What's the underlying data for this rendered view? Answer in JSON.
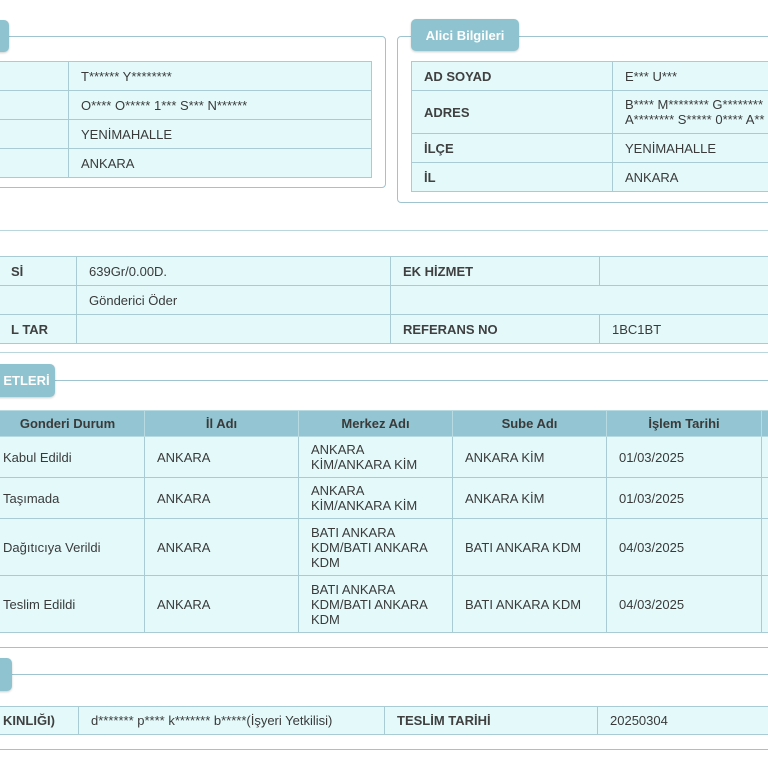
{
  "sender": {
    "tab_label": "",
    "rows": [
      {
        "label": "",
        "value": "T****** Y********"
      },
      {
        "label": "",
        "value": "O**** O***** 1*** S*** N******"
      },
      {
        "label": "",
        "value": "YENİMAHALLE"
      },
      {
        "label": "",
        "value": "ANKARA"
      }
    ]
  },
  "receiver": {
    "tab_label": "Alici Bilgileri",
    "rows": [
      {
        "label": "AD SOYAD",
        "value": "E*** U***"
      },
      {
        "label": "ADRES",
        "value": "B**** M******** G********\nA******** S***** 0**** A**"
      },
      {
        "label": "İLÇE",
        "value": "YENİMAHALLE"
      },
      {
        "label": "İL",
        "value": "ANKARA"
      }
    ]
  },
  "shipment": {
    "r1": {
      "l1": "Sİ",
      "v1": "639Gr/0.00D.",
      "l2": "EK HİZMET",
      "v2": ""
    },
    "r2": {
      "l1": "",
      "v1": "Gönderici Öder"
    },
    "r3": {
      "l1": "L TAR",
      "v1": "",
      "l2": "REFERANS NO",
      "v2": "1BC1BT"
    }
  },
  "movements": {
    "tab_label": "ETLERİ",
    "headers": [
      "Gonderi Durum",
      "İl Adı",
      "Merkez Adı",
      "Sube Adı",
      "İşlem Tarihi"
    ],
    "rows": [
      {
        "status": "Kabul Edildi",
        "city": "ANKARA",
        "center": "ANKARA KİM/ANKARA KİM",
        "branch": "ANKARA KİM",
        "date": "01/03/2025"
      },
      {
        "status": "Taşımada",
        "city": "ANKARA",
        "center": "ANKARA KİM/ANKARA KİM",
        "branch": "ANKARA KİM",
        "date": "01/03/2025"
      },
      {
        "status": "Dağıtıcıya Verildi",
        "city": "ANKARA",
        "center": "BATI ANKARA KDM/BATI ANKARA KDM",
        "branch": "BATI ANKARA KDM",
        "date": "04/03/2025"
      },
      {
        "status": "Teslim Edildi",
        "city": "ANKARA",
        "center": "BATI ANKARA KDM/BATI ANKARA KDM",
        "branch": "BATI ANKARA KDM",
        "date": "04/03/2025"
      }
    ]
  },
  "delivery": {
    "tab_label": "",
    "label1": "KINLIĞI)",
    "value1": "d******* p**** k******* b*****(İşyeri Yetkilisi)",
    "label2": "TESLİM TARİHİ",
    "value2": "20250304"
  }
}
